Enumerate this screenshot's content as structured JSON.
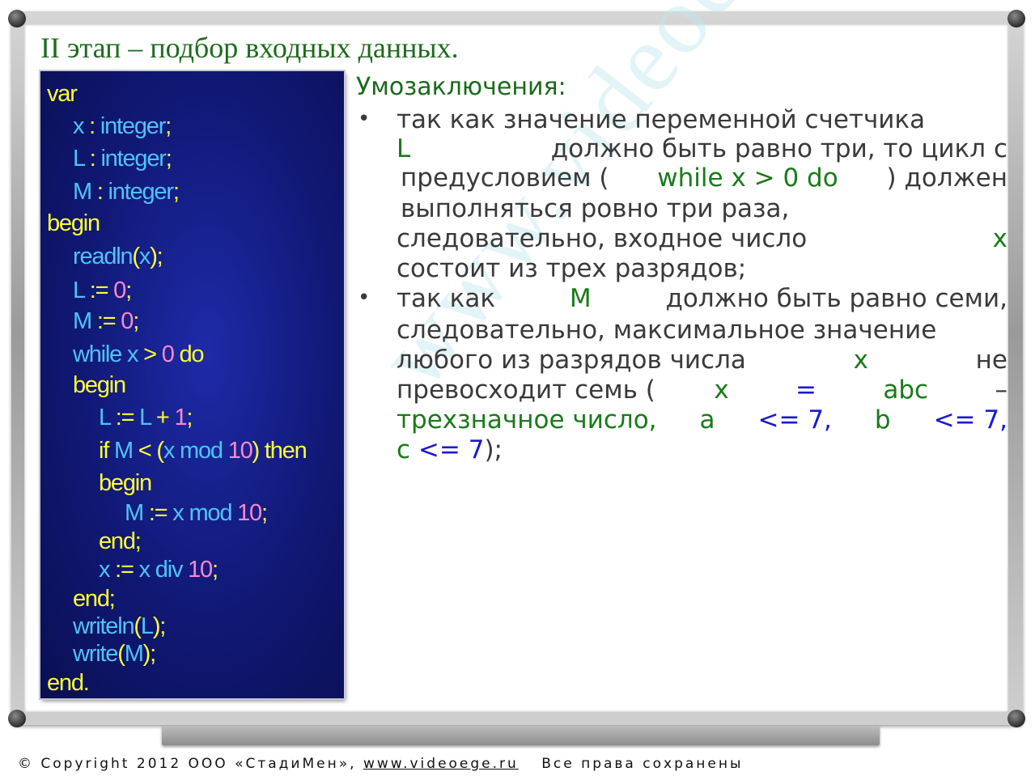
{
  "title": "II этап – подбор входных данных.",
  "watermark": "www.videoege.ru",
  "code_lines": [
    [
      {
        "t": "var",
        "c": "kw"
      }
    ],
    [
      {
        "t": "x",
        "c": "id"
      },
      {
        "t": " : ",
        "c": "op"
      },
      {
        "t": "integer",
        "c": "id"
      },
      {
        "t": ";",
        "c": "op"
      }
    ],
    [
      {
        "t": "L",
        "c": "id"
      },
      {
        "t": " : ",
        "c": "op"
      },
      {
        "t": "integer",
        "c": "id"
      },
      {
        "t": ";",
        "c": "op"
      }
    ],
    [
      {
        "t": "M",
        "c": "id"
      },
      {
        "t": " : ",
        "c": "op"
      },
      {
        "t": "integer",
        "c": "id"
      },
      {
        "t": ";",
        "c": "op"
      }
    ],
    [
      {
        "t": "begin",
        "c": "kw"
      }
    ],
    [
      {
        "t": "readln",
        "c": "id"
      },
      {
        "t": "(",
        "c": "op"
      },
      {
        "t": "x",
        "c": "id"
      },
      {
        "t": ");",
        "c": "op"
      }
    ],
    [
      {
        "t": "L",
        "c": "id"
      },
      {
        "t": " := ",
        "c": "op"
      },
      {
        "t": "0",
        "c": "num"
      },
      {
        "t": ";",
        "c": "op"
      }
    ],
    [
      {
        "t": "M",
        "c": "id"
      },
      {
        "t": " := ",
        "c": "op"
      },
      {
        "t": "0",
        "c": "num"
      },
      {
        "t": ";",
        "c": "op"
      }
    ],
    [
      {
        "t": "while",
        "c": "id"
      },
      {
        "t": " x ",
        "c": "id"
      },
      {
        "t": "> ",
        "c": "op"
      },
      {
        "t": "0",
        "c": "num"
      },
      {
        "t": " do",
        "c": "kw"
      }
    ],
    [
      {
        "t": "begin",
        "c": "kw"
      }
    ],
    [
      {
        "t": "L",
        "c": "id"
      },
      {
        "t": " := ",
        "c": "op"
      },
      {
        "t": "L",
        "c": "id"
      },
      {
        "t": " + ",
        "c": "op"
      },
      {
        "t": "1",
        "c": "num"
      },
      {
        "t": ";",
        "c": "op"
      }
    ],
    [
      {
        "t": "if",
        "c": "kw"
      },
      {
        "t": " M ",
        "c": "id"
      },
      {
        "t": "< (",
        "c": "op"
      },
      {
        "t": "x mod ",
        "c": "id"
      },
      {
        "t": "10",
        "c": "num"
      },
      {
        "t": ") then",
        "c": "kw"
      }
    ],
    [
      {
        "t": "begin",
        "c": "kw"
      }
    ],
    [
      {
        "t": "M",
        "c": "id"
      },
      {
        "t": " := ",
        "c": "op"
      },
      {
        "t": "x mod ",
        "c": "id"
      },
      {
        "t": "10",
        "c": "num"
      },
      {
        "t": ";",
        "c": "op"
      }
    ],
    [
      {
        "t": "end;",
        "c": "kw"
      }
    ],
    [
      {
        "t": "x",
        "c": "id"
      },
      {
        "t": " := ",
        "c": "op"
      },
      {
        "t": "x div ",
        "c": "id"
      },
      {
        "t": "10",
        "c": "num"
      },
      {
        "t": ";",
        "c": "op"
      }
    ],
    [
      {
        "t": "end;",
        "c": "kw"
      }
    ],
    [
      {
        "t": "writeln",
        "c": "id"
      },
      {
        "t": "(",
        "c": "op"
      },
      {
        "t": "L",
        "c": "id"
      },
      {
        "t": ");",
        "c": "op"
      }
    ],
    [
      {
        "t": "write",
        "c": "id"
      },
      {
        "t": "(",
        "c": "op"
      },
      {
        "t": "M",
        "c": "id"
      },
      {
        "t": ");",
        "c": "op"
      }
    ],
    [
      {
        "t": "end.",
        "c": "kw"
      }
    ]
  ],
  "conclusions_heading": "Умозаключения:",
  "text_lines": [
    [
      {
        "t": "так как значение переменной счетчика",
        "c": ""
      }
    ],
    [
      {
        "t": "L",
        "c": "g"
      },
      {
        "t": " должно быть равно три, то цикл с",
        "c": ""
      }
    ],
    [
      {
        "t": "предусловием (",
        "c": ""
      },
      {
        "t": "while x > 0 do",
        "c": "g"
      },
      {
        "t": ") должен",
        "c": ""
      }
    ],
    [
      {
        "t": "выполняться ровно три раза,",
        "c": ""
      }
    ],
    [
      {
        "t": "следовательно, входное число ",
        "c": ""
      },
      {
        "t": "x",
        "c": "g"
      }
    ],
    [
      {
        "t": "состоит из трех разрядов;",
        "c": ""
      }
    ],
    [
      {
        "t": "так как ",
        "c": ""
      },
      {
        "t": "M",
        "c": "g"
      },
      {
        "t": " должно быть равно семи,",
        "c": ""
      }
    ],
    [
      {
        "t": "следовательно, максимальное значение",
        "c": ""
      }
    ],
    [
      {
        "t": "любого из разрядов числа ",
        "c": ""
      },
      {
        "t": "x",
        "c": "g"
      },
      {
        "t": " не",
        "c": ""
      }
    ],
    [
      {
        "t": "превосходит семь (",
        "c": ""
      },
      {
        "t": "x",
        "c": "g"
      },
      {
        "t": " = ",
        "c": "b"
      },
      {
        "t": "abc",
        "c": "g"
      },
      {
        "t": " –",
        "c": ""
      }
    ],
    [
      {
        "t": "трехзначное число, ",
        "c": "g"
      },
      {
        "t": "a",
        "c": "g"
      },
      {
        "t": " <= 7, ",
        "c": "b"
      },
      {
        "t": "b",
        "c": "g"
      },
      {
        "t": " <= 7,",
        "c": "b"
      }
    ],
    [
      {
        "t": "c",
        "c": "g"
      },
      {
        "t": " <= 7",
        "c": "b"
      },
      {
        "t": ");",
        "c": ""
      }
    ]
  ],
  "bullet_char": "•",
  "footer": {
    "copyright_symbol": "©",
    "copyright_text": "Copyright 2012 ООО «СтадиМен»,",
    "site": "www.videoege.ru",
    "rights": "Все права сохранены"
  }
}
